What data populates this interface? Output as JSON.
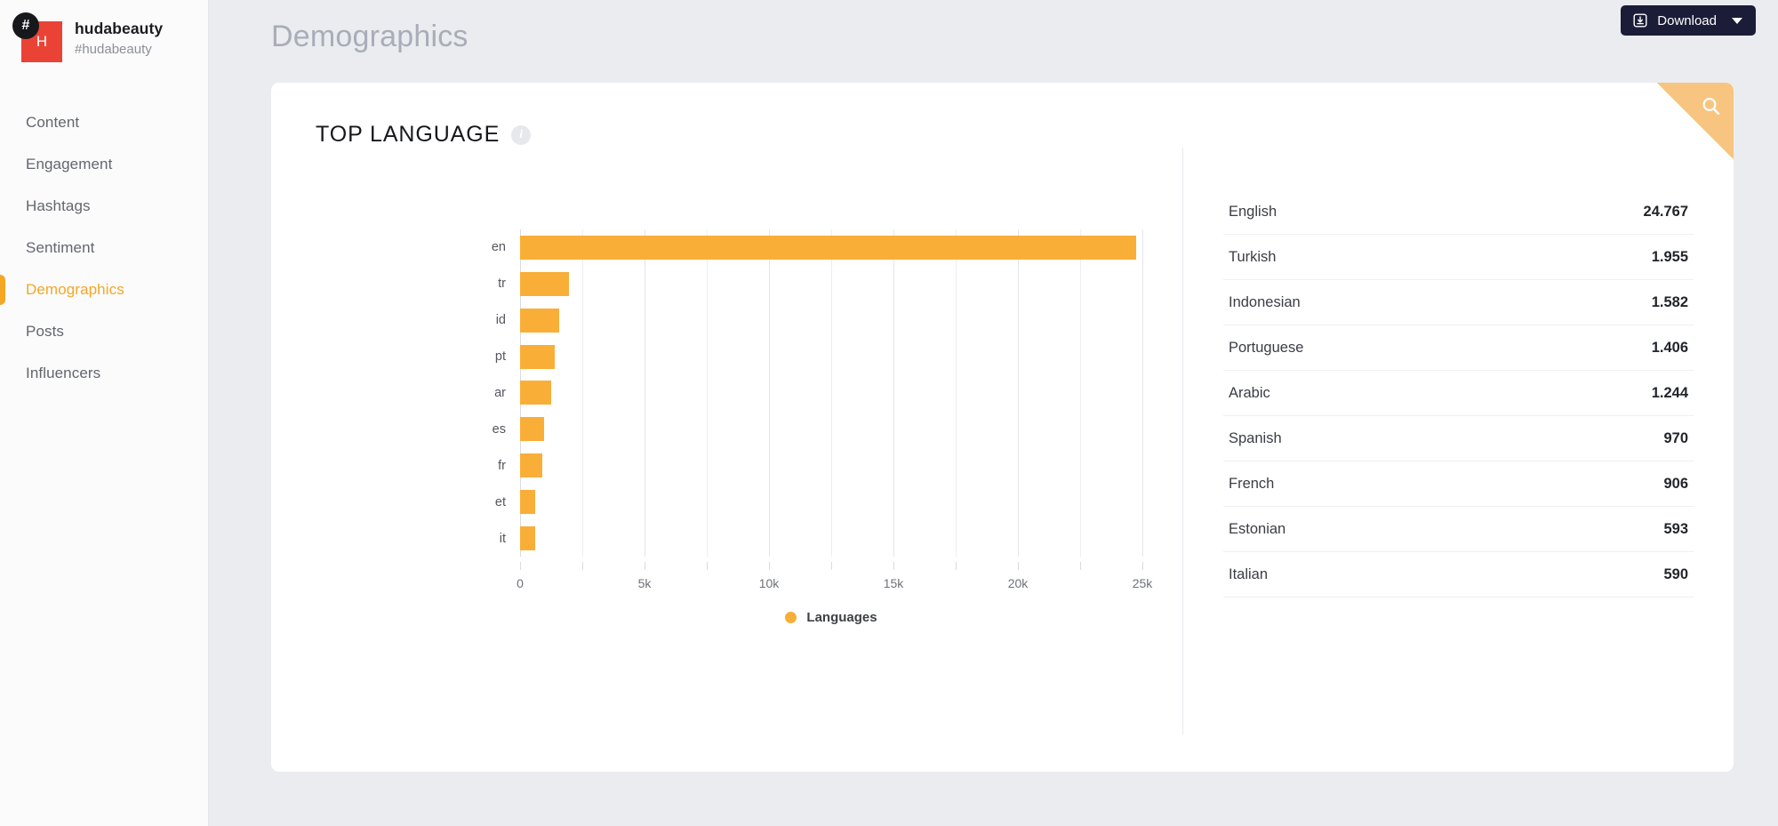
{
  "sidebar": {
    "avatar_initial": "H",
    "hash_badge": "#",
    "profile_name": "hudabeauty",
    "profile_handle": "#hudabeauty",
    "items": [
      {
        "label": "Content",
        "active": false
      },
      {
        "label": "Engagement",
        "active": false
      },
      {
        "label": "Hashtags",
        "active": false
      },
      {
        "label": "Sentiment",
        "active": false
      },
      {
        "label": "Demographics",
        "active": true
      },
      {
        "label": "Posts",
        "active": false
      },
      {
        "label": "Influencers",
        "active": false
      }
    ]
  },
  "header": {
    "title": "Demographics",
    "download_label": "Download",
    "download_icon": "download-icon",
    "caret_icon": "chevron-down-icon"
  },
  "card": {
    "title": "TOP LANGUAGE",
    "info_icon": "info-icon",
    "info_glyph": "i",
    "search_icon": "search-icon"
  },
  "colors": {
    "bar": "#f9ae38",
    "accent": "#f5a623",
    "avatar": "#ea4335",
    "download_bg": "#1b1c38",
    "ribbon": "#f7c57f",
    "page_bg": "#eaecf0"
  },
  "chart_data": {
    "type": "bar",
    "orientation": "horizontal",
    "title": "TOP LANGUAGE",
    "xlabel": "",
    "ylabel": "",
    "categories": [
      "en",
      "tr",
      "id",
      "pt",
      "ar",
      "es",
      "fr",
      "et",
      "it"
    ],
    "values": [
      24767,
      1955,
      1582,
      1406,
      1244,
      970,
      906,
      593,
      590
    ],
    "xlim": [
      0,
      25000
    ],
    "xticks": [
      0,
      5000,
      10000,
      15000,
      20000,
      25000
    ],
    "xtick_labels": [
      "0",
      "5k",
      "10k",
      "15k",
      "20k",
      "25k"
    ],
    "minor_gridline_step": 2500,
    "grid": true,
    "legend": [
      "Languages"
    ],
    "legend_position": "bottom",
    "series": [
      {
        "name": "Languages",
        "color": "#f9ae38",
        "values": [
          24767,
          1955,
          1582,
          1406,
          1244,
          970,
          906,
          593,
          590
        ]
      }
    ]
  },
  "list": {
    "rows": [
      {
        "name": "English",
        "value": "24.767"
      },
      {
        "name": "Turkish",
        "value": "1.955"
      },
      {
        "name": "Indonesian",
        "value": "1.582"
      },
      {
        "name": "Portuguese",
        "value": "1.406"
      },
      {
        "name": "Arabic",
        "value": "1.244"
      },
      {
        "name": "Spanish",
        "value": "970"
      },
      {
        "name": "French",
        "value": "906"
      },
      {
        "name": "Estonian",
        "value": "593"
      },
      {
        "name": "Italian",
        "value": "590"
      }
    ]
  }
}
